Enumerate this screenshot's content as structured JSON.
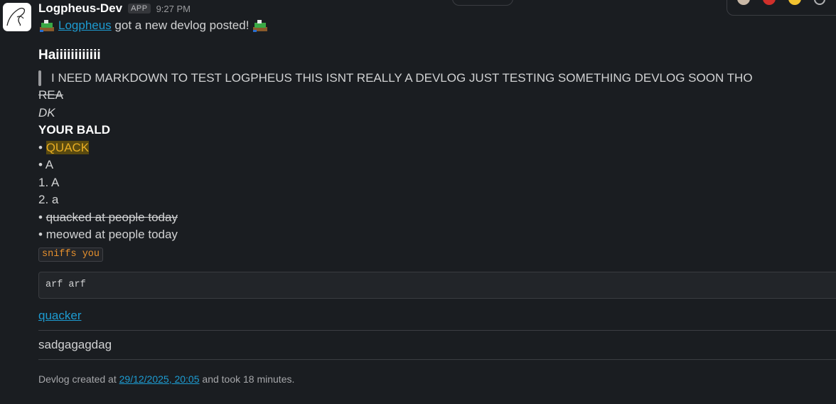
{
  "message": {
    "sender": "Logpheus-Dev",
    "badge": "APP",
    "time": "9:27 PM",
    "intro_link": "Logpheus",
    "intro_text": " got a new devlog posted! "
  },
  "devlog": {
    "title": "Haiiiiiiiiiiii",
    "quote": "I NEED MARKDOWN TO TEST LOGPHEUS THIS ISNT REALLY A DEVLOG JUST TESTING SOMETHING DEVLOG SOON THO",
    "strike_text": "REA",
    "italic_text": "DK",
    "bold_text": "YOUR BALD",
    "bullet_char": "•",
    "bullet_highlight": "QUACK",
    "bullet_2": "A",
    "ordered_1": "1. A",
    "ordered_2": "2. a",
    "bullet_strike": "quacked at people today",
    "bullet_plain": "meowed at people today",
    "inline_code": "sniffs you",
    "code_block": "arf arf",
    "link_text": "quacker",
    "plain_text": "sadgagagdag"
  },
  "footer": {
    "prefix": "Devlog created at ",
    "date_link": "29/12/2025, 20:05",
    "suffix": " and took 18 minutes."
  },
  "colors": {
    "background": "#1a1d21",
    "link": "#1d9bd1",
    "highlight": "#e8ad23",
    "code": "#e8912d"
  }
}
